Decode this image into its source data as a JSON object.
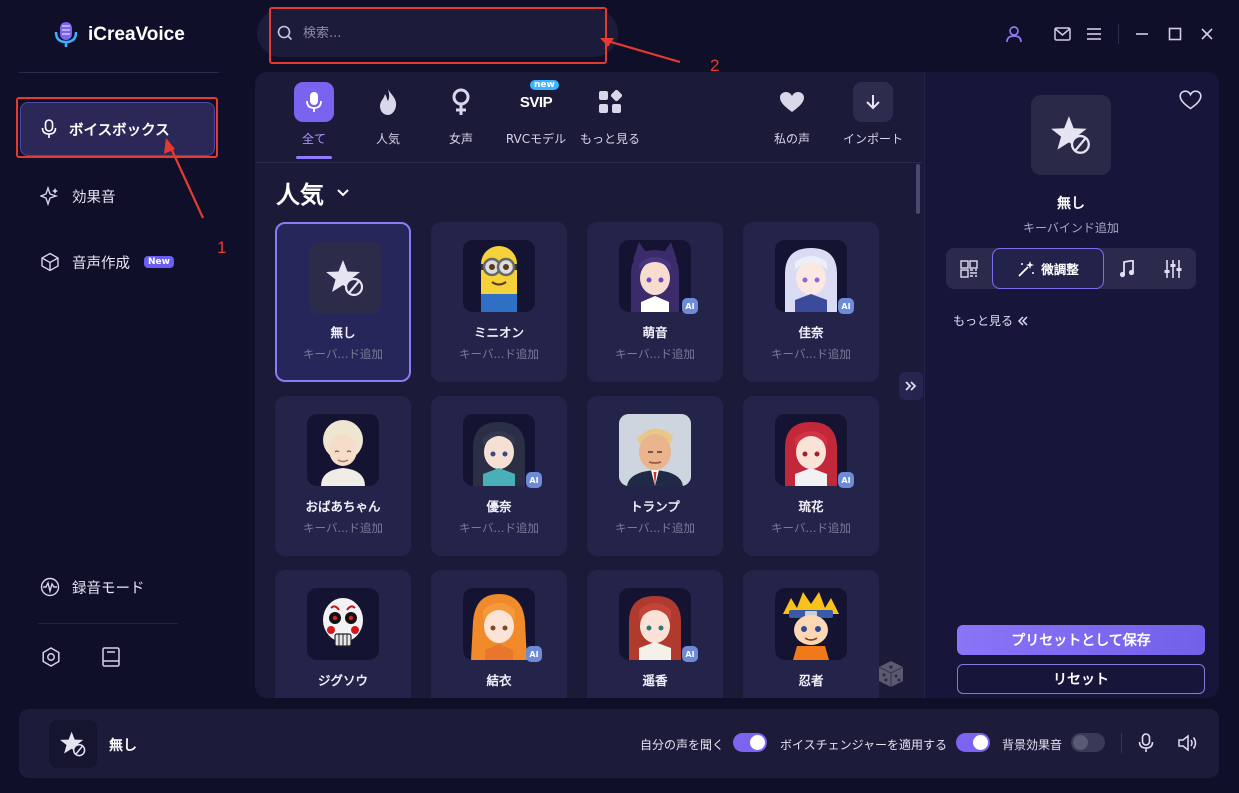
{
  "app": {
    "title": "iCreaVoice",
    "accent": "#7d63f0"
  },
  "search": {
    "placeholder": "検索..."
  },
  "annotations": {
    "label_1": "1",
    "label_2": "2"
  },
  "sidebar": {
    "items": [
      {
        "label": "ボイスボックス",
        "icon": "mic-icon",
        "active": true
      },
      {
        "label": "効果音",
        "icon": "sparkle-icon"
      },
      {
        "label": "音声作成",
        "icon": "cube-icon",
        "badge": "New"
      }
    ],
    "record_mode": "録音モード"
  },
  "tabs": [
    {
      "label": "全て",
      "icon": "mic-icon",
      "active": true
    },
    {
      "label": "人気",
      "icon": "fire-icon"
    },
    {
      "label": "女声",
      "icon": "female-icon"
    },
    {
      "label": "RVCモデル",
      "icon": "svip-icon",
      "badge": "new",
      "icon_text": "SVIP"
    },
    {
      "label": "もっと見る",
      "icon": "grid-icon"
    },
    {
      "label": "私の声",
      "icon": "heart-icon"
    },
    {
      "label": "インポート",
      "icon": "download-icon"
    }
  ],
  "section": {
    "title": "人気"
  },
  "voices": [
    {
      "name": "無し",
      "sub": "キーバ...ド追加",
      "icon": "no-effect-icon",
      "selected": true
    },
    {
      "name": "ミニオン",
      "sub": "キーバ...ド追加",
      "icon": "minion-avatar"
    },
    {
      "name": "萌音",
      "sub": "キーバ...ド追加",
      "icon": "anime-girl-avatar",
      "ai": "AI"
    },
    {
      "name": "佳奈",
      "sub": "キーバ...ド追加",
      "icon": "anime-girl-avatar",
      "ai": "AI"
    },
    {
      "name": "おばあちゃん",
      "sub": "キーバ...ド追加",
      "icon": "grandma-avatar"
    },
    {
      "name": "優奈",
      "sub": "キーバ...ド追加",
      "icon": "anime-girl-avatar",
      "ai": "AI"
    },
    {
      "name": "トランプ",
      "sub": "キーバ...ド追加",
      "icon": "man-avatar"
    },
    {
      "name": "琉花",
      "sub": "キーバ...ド追加",
      "icon": "anime-girl-avatar",
      "ai": "AI"
    },
    {
      "name": "ジグソウ",
      "sub": "キーバ...ド追加",
      "icon": "skull-avatar"
    },
    {
      "name": "結衣",
      "sub": "キーバ...ド追加",
      "icon": "anime-girl-avatar",
      "ai": "AI"
    },
    {
      "name": "遥香",
      "sub": "キーバ...ド追加",
      "icon": "anime-girl-avatar",
      "ai": "AI"
    },
    {
      "name": "忍者",
      "sub": "キーバ...ド追加",
      "icon": "ninja-avatar"
    }
  ],
  "right_panel": {
    "name": "無し",
    "sub": "キーバインド追加",
    "active_tab": "微調整",
    "more": "もっと見る",
    "save_preset": "プリセットとして保存",
    "reset": "リセット"
  },
  "bottom": {
    "current_voice": "無し",
    "toggle1": {
      "label": "自分の声を聞く",
      "on": true
    },
    "toggle2": {
      "label": "ボイスチェンジャーを適用する",
      "on": true
    },
    "toggle3": {
      "label": "背景効果音",
      "on": false
    }
  }
}
